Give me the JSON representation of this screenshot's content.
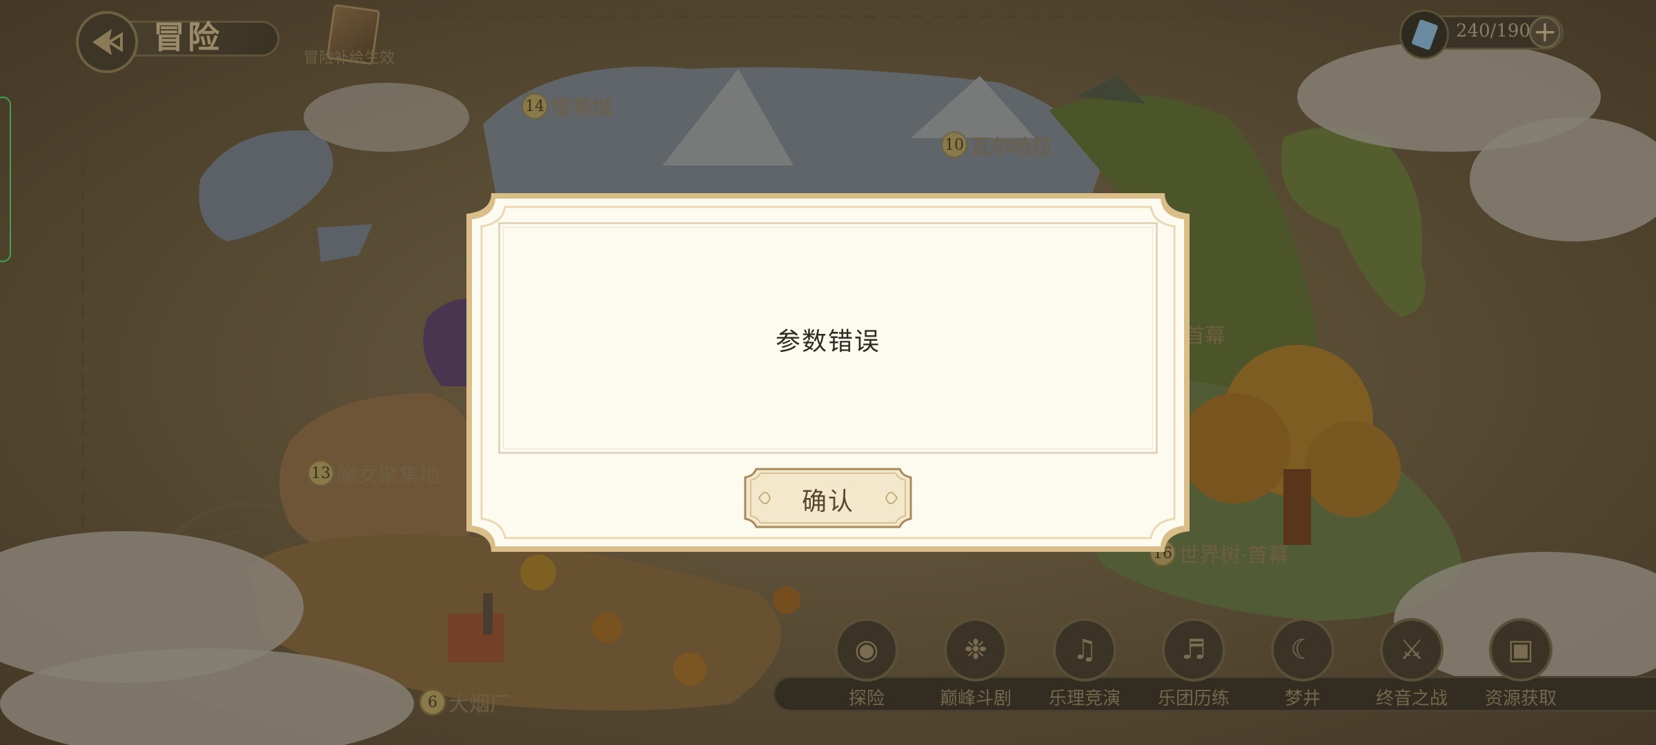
{
  "header": {
    "title": "冒险",
    "book_label": "冒险补给生效",
    "resource_count": "240/190",
    "add_label": "+"
  },
  "map": {
    "locations": [
      {
        "num": "14",
        "name": "雪蒂城"
      },
      {
        "num": "10",
        "name": "瓦尔哈拉"
      },
      {
        "num": "13",
        "name": "魔女聚集地"
      },
      {
        "num": "16",
        "name": "世界树·首幕"
      },
      {
        "num": "6",
        "name": "大烟厂"
      }
    ],
    "partial_label": "首幕"
  },
  "nav": [
    {
      "label": "探险",
      "icon": "compass-icon"
    },
    {
      "label": "巅峰斗剧",
      "icon": "crest-icon"
    },
    {
      "label": "乐理竞演",
      "icon": "music-note-icon"
    },
    {
      "label": "乐团历练",
      "icon": "horn-icon"
    },
    {
      "label": "梦井",
      "icon": "sleep-icon"
    },
    {
      "label": "终音之战",
      "icon": "sword-shield-icon"
    },
    {
      "label": "资源获取",
      "icon": "chest-icon"
    }
  ],
  "dialog": {
    "message": "参数错误",
    "confirm_label": "确认"
  },
  "colors": {
    "dialog_bg": "#fdfaf0",
    "dialog_border": "#d9be8a",
    "button_bg": "#f3e8cc"
  }
}
